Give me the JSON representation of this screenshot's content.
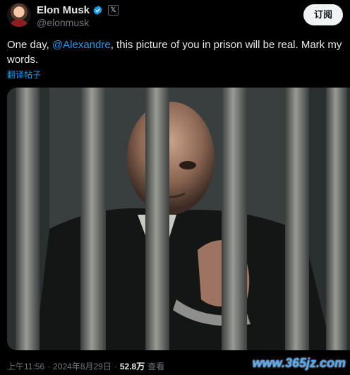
{
  "author": {
    "display_name": "Elon Musk",
    "handle": "@elonmusk",
    "badge": "𝕏",
    "verified_color": "#1d9bf0"
  },
  "subscribe_label": "订阅",
  "tweet": {
    "text_before": "One day, ",
    "mention": "@Alexandre",
    "text_after": ", this picture of you in prison will be real. Mark my words.",
    "translate_label": "翻译帖子"
  },
  "meta": {
    "time": "上午11:56",
    "sep1": "·",
    "date": "2024年8月29日",
    "sep2": "·",
    "views": "52.8万",
    "views_label": "查看"
  },
  "watermark": "www.365jz.com",
  "colors": {
    "accent": "#1d9bf0",
    "background": "#000000",
    "muted": "#71767b"
  }
}
